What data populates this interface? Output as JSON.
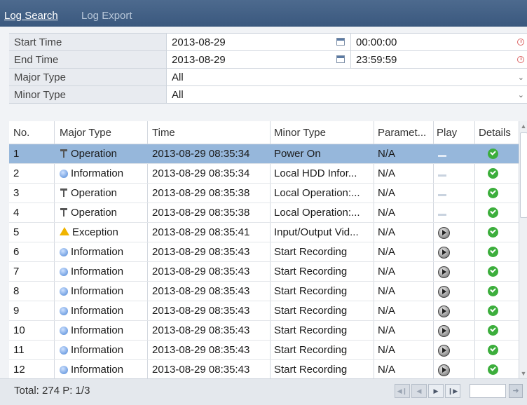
{
  "tabs": [
    {
      "label": "Log Search",
      "active": true
    },
    {
      "label": "Log Export",
      "active": false
    }
  ],
  "filters": {
    "start_time_label": "Start Time",
    "start_date": "2013-08-29",
    "start_clock": "00:00:00",
    "end_time_label": "End Time",
    "end_date": "2013-08-29",
    "end_clock": "23:59:59",
    "major_type_label": "Major Type",
    "major_type_value": "All",
    "minor_type_label": "Minor Type",
    "minor_type_value": "All"
  },
  "table": {
    "headers": [
      "No.",
      "Major Type",
      "Time",
      "Minor Type",
      "Paramet...",
      "Play",
      "Details"
    ],
    "rows": [
      {
        "no": "1",
        "major": "Operation",
        "icon": "operation-icon",
        "time": "2013-08-29 08:35:34",
        "minor": "Power On",
        "param": "N/A",
        "play": "none",
        "selected": true
      },
      {
        "no": "2",
        "major": "Information",
        "icon": "information-icon",
        "time": "2013-08-29 08:35:34",
        "minor": "Local HDD Infor...",
        "param": "N/A",
        "play": "none"
      },
      {
        "no": "3",
        "major": "Operation",
        "icon": "operation-icon",
        "time": "2013-08-29 08:35:38",
        "minor": "Local Operation:...",
        "param": "N/A",
        "play": "none"
      },
      {
        "no": "4",
        "major": "Operation",
        "icon": "operation-icon",
        "time": "2013-08-29 08:35:38",
        "minor": "Local Operation:...",
        "param": "N/A",
        "play": "none"
      },
      {
        "no": "5",
        "major": "Exception",
        "icon": "exception-icon",
        "time": "2013-08-29 08:35:41",
        "minor": "Input/Output Vid...",
        "param": "N/A",
        "play": "play"
      },
      {
        "no": "6",
        "major": "Information",
        "icon": "information-icon",
        "time": "2013-08-29 08:35:43",
        "minor": "Start Recording",
        "param": "N/A",
        "play": "play"
      },
      {
        "no": "7",
        "major": "Information",
        "icon": "information-icon",
        "time": "2013-08-29 08:35:43",
        "minor": "Start Recording",
        "param": "N/A",
        "play": "play"
      },
      {
        "no": "8",
        "major": "Information",
        "icon": "information-icon",
        "time": "2013-08-29 08:35:43",
        "minor": "Start Recording",
        "param": "N/A",
        "play": "play"
      },
      {
        "no": "9",
        "major": "Information",
        "icon": "information-icon",
        "time": "2013-08-29 08:35:43",
        "minor": "Start Recording",
        "param": "N/A",
        "play": "play"
      },
      {
        "no": "10",
        "major": "Information",
        "icon": "information-icon",
        "time": "2013-08-29 08:35:43",
        "minor": "Start Recording",
        "param": "N/A",
        "play": "play"
      },
      {
        "no": "11",
        "major": "Information",
        "icon": "information-icon",
        "time": "2013-08-29 08:35:43",
        "minor": "Start Recording",
        "param": "N/A",
        "play": "play"
      },
      {
        "no": "12",
        "major": "Information",
        "icon": "information-icon",
        "time": "2013-08-29 08:35:43",
        "minor": "Start Recording",
        "param": "N/A",
        "play": "play"
      }
    ]
  },
  "footer": {
    "summary": "Total: 274  P: 1/3"
  },
  "colors": {
    "selected_row": "#96b7db",
    "tabbar": "#3f5d83"
  }
}
